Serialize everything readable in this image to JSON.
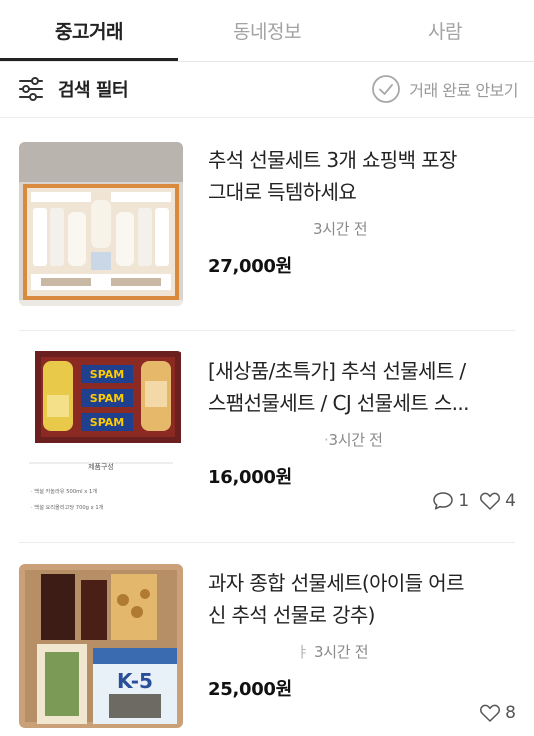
{
  "tabs": [
    {
      "label": "중고거래",
      "active": true
    },
    {
      "label": "동네정보",
      "active": false
    },
    {
      "label": "사람",
      "active": false
    }
  ],
  "filter": {
    "label": "검색 필터",
    "hide_completed_label": "거래 완료 안보기",
    "icons": {
      "filter": "sliders-icon",
      "check": "circle-check-icon"
    }
  },
  "items": [
    {
      "title_line1": "추석 선물세트 3개 쇼핑백 포장",
      "title_line2": "그대로 득템하세요",
      "time": "3시간 전",
      "price": "27,000원"
    },
    {
      "title_line1": "[새상품/초특가] 추석 선물세트 /",
      "title_line2": "스팸선물세트 / CJ 선물세트 스...",
      "time": "3시간 전",
      "time_prefix": "·",
      "price": "16,000원",
      "comments": "1",
      "likes": "4"
    },
    {
      "title_line1": "과자 종합 선물세트(아이들 어르",
      "title_line2": "신 추석 선물로 강추)",
      "time": "3시간 전",
      "time_prefix": "ㅑ",
      "price": "25,000원",
      "likes": "8"
    }
  ],
  "thumb2_text": {
    "caption": "제품구성",
    "line1": "· 백설 카놀라유 500ml x 1개",
    "line2": "· 백설 요리올리고당 700g x 1개",
    "brand": "SPAM"
  },
  "thumb3_text": {
    "box_label": "K-5"
  },
  "colors": {
    "text": "#222222",
    "muted": "#9a9a9a",
    "divider": "#ececec",
    "spam_blue": "#1f3f8f"
  }
}
